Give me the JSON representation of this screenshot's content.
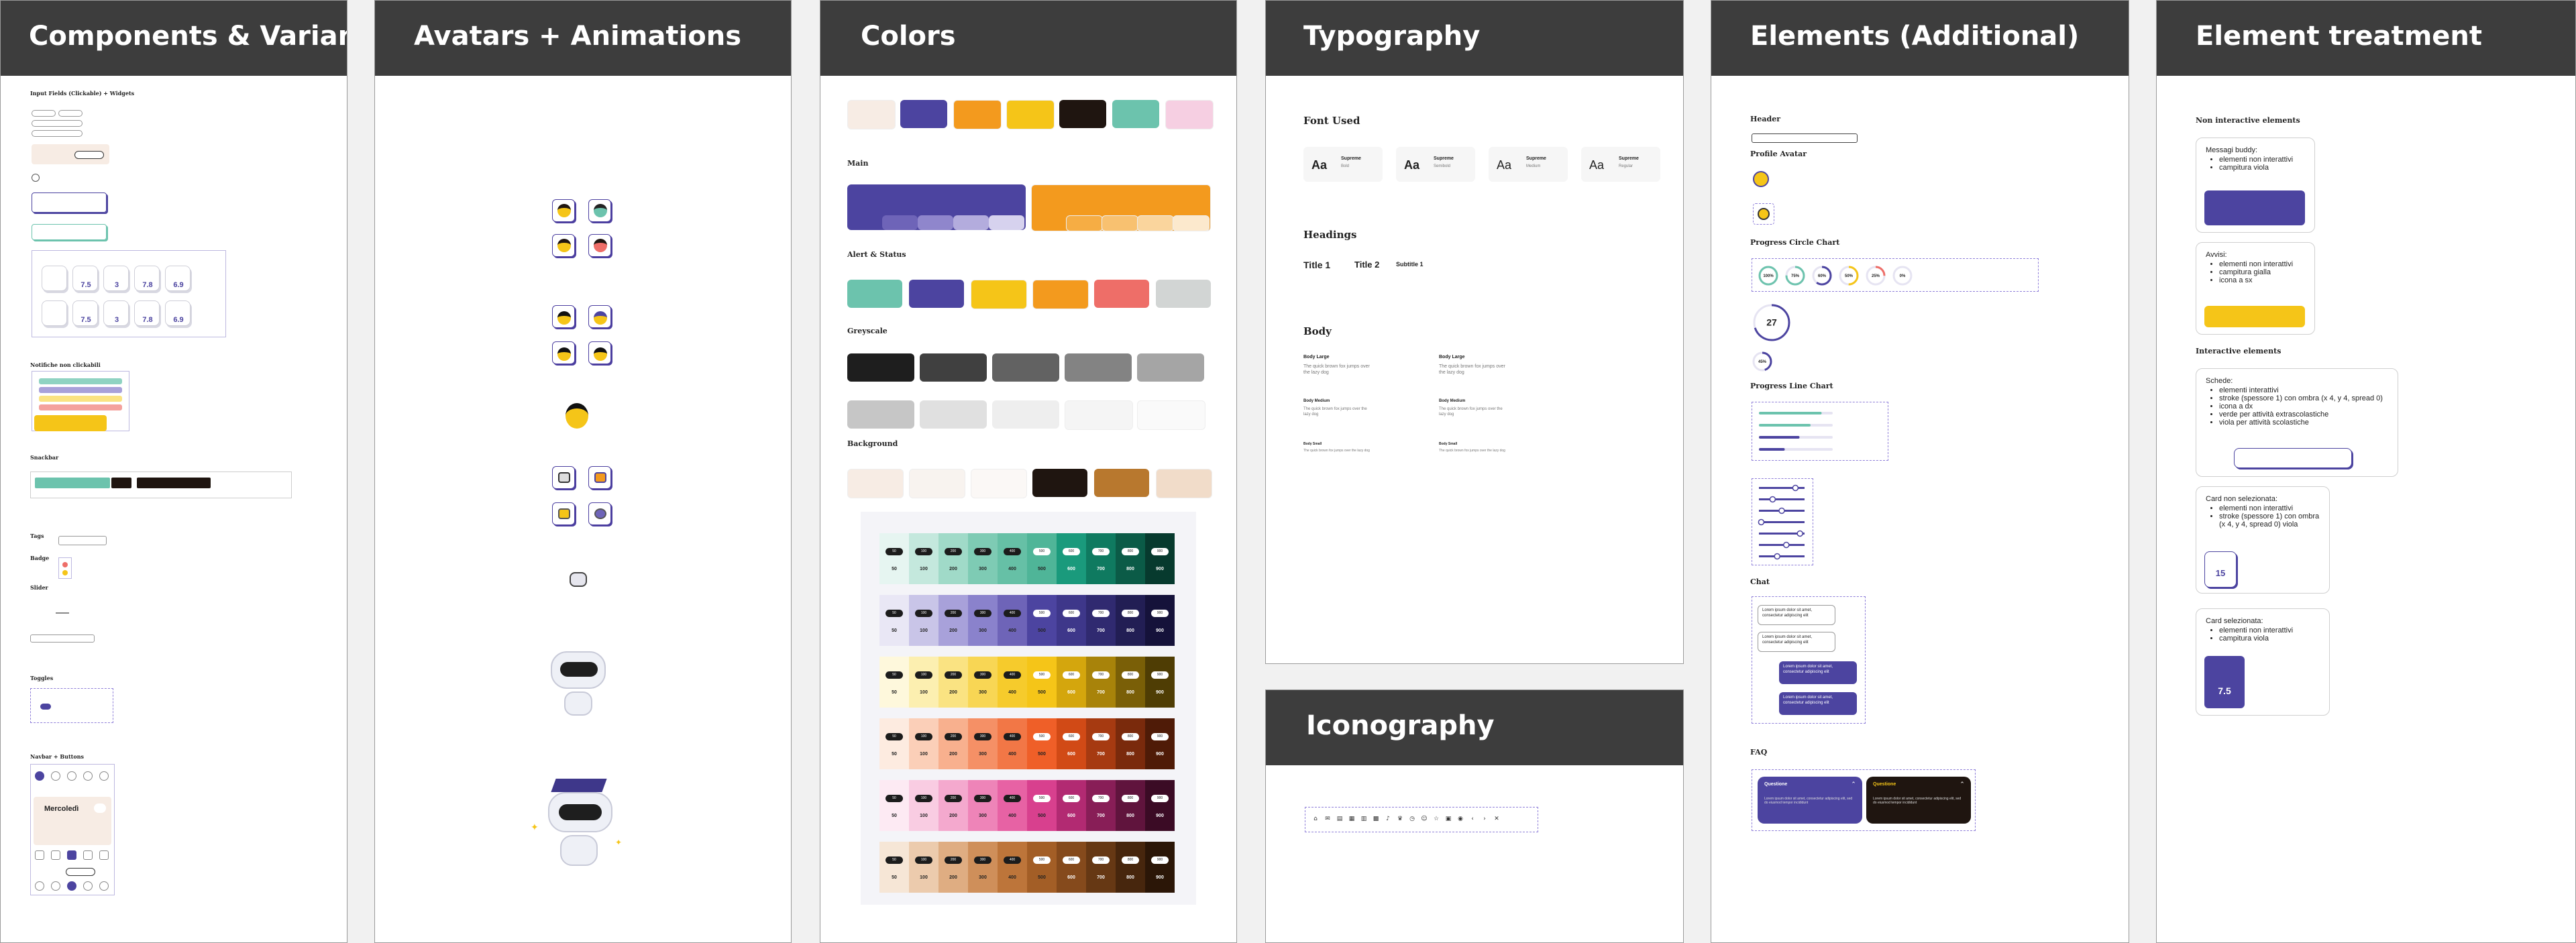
{
  "boards": {
    "components": "Components & Variants",
    "avatars": "Avatars + Animations",
    "colors": "Colors",
    "typography": "Typography",
    "elements": "Elements (Additional)",
    "treatment": "Element treatment",
    "iconography": "Iconography"
  },
  "components": {
    "input_fields": "Input Fields (Clickable) + Widgets",
    "notifiche": "Notifiche non clickabili",
    "snackbar": "Snackbar",
    "tags": "Tags",
    "badge": "Badge",
    "slider": "Slider",
    "toggles": "Toggles",
    "navbar": "Navbar + Buttons",
    "navbar_day": "Mercoledì",
    "grade_values": [
      "7.5",
      "3",
      "7.8",
      "6.9",
      "7.5",
      "3",
      "7.8",
      "6.9"
    ]
  },
  "avatars": {
    "avatar_count": 10
  },
  "colors": {
    "main": "Main",
    "alert": "Alert & Status",
    "greyscale": "Greyscale",
    "background": "Background",
    "top_swatches": [
      "#f7ece4",
      "#4c44a0",
      "#f39a1e",
      "#f5c518",
      "#1f1510",
      "#6cc3ad",
      "#f6cfe2"
    ],
    "main_swatches": [
      "#4c44a0",
      "#f39a1e"
    ],
    "main_tints": [
      "#6e64b8",
      "#8f86cc",
      "#b3acdd",
      "#d6d2ee",
      "#f6ad44",
      "#f8c170",
      "#fad59d",
      "#fce9cd"
    ],
    "alert_swatches": [
      "#6cc3ad",
      "#4c44a0",
      "#f5c518",
      "#f39a1e",
      "#ee6e68",
      "#d2d5d4"
    ],
    "greyscale_swatches": [
      "#1e1e1e",
      "#404040",
      "#626262",
      "#838383",
      "#a5a5a5",
      "#c6c6c6",
      "#e0e0e0",
      "#eeeeee",
      "#f5f5f5",
      "#fafafa"
    ],
    "background_swatches": [
      "#f7ece4",
      "#f8f3ef",
      "#fbf8f6",
      "#1f1510",
      "#b8782e",
      "#f1dcc9"
    ],
    "shade_steps": [
      "50",
      "100",
      "200",
      "300",
      "400",
      "500",
      "600",
      "700",
      "800",
      "900"
    ],
    "palettes": [
      [
        "#e6f5f1",
        "#c4e8dd",
        "#a0dac8",
        "#7ecbb4",
        "#66c0a6",
        "#4fb598",
        "#1a9a7c",
        "#0f7a60",
        "#0b5b47",
        "#073a2e"
      ],
      [
        "#e9e7f5",
        "#c9c5e8",
        "#a8a1da",
        "#8a82cc",
        "#6e64b8",
        "#4c44a0",
        "#3e378a",
        "#302a70",
        "#221e54",
        "#15123a"
      ],
      [
        "#fef8dc",
        "#fcefb0",
        "#fae382",
        "#f8d654",
        "#f6cb2c",
        "#f5c518",
        "#d4a60d",
        "#a8830a",
        "#7a5f07",
        "#4f3d04"
      ],
      [
        "#fdebe0",
        "#fbcfb8",
        "#f8b08e",
        "#f59066",
        "#f27746",
        "#ef5f28",
        "#d14a16",
        "#a63a11",
        "#7a2a0c",
        "#4f1b07"
      ],
      [
        "#fdeaf3",
        "#f9cce2",
        "#f4a9ce",
        "#ee84b8",
        "#e762a4",
        "#d8408e",
        "#b22a72",
        "#881e57",
        "#60143d",
        "#3b0b25"
      ],
      [
        "#f6e6d6",
        "#eccbad",
        "#dfad82",
        "#cf8f5a",
        "#bd753a",
        "#a35e26",
        "#854a1c",
        "#663814",
        "#47260d",
        "#2b1607"
      ]
    ]
  },
  "typography": {
    "font_used": "Font Used",
    "aa": "Aa",
    "font_name": "Supreme",
    "font_weights": [
      "Bold",
      "Semibold",
      "Medium",
      "Regular"
    ],
    "headings": "Headings",
    "title1": "Title 1",
    "title2": "Title 2",
    "subtitle1": "Subtitle 1",
    "body": "Body",
    "body_large": "Body Large",
    "body_medium": "Body Medium",
    "body_small": "Body Small",
    "sample": "The quick brown fox jumps over the lazy dog"
  },
  "elements": {
    "header": "Header",
    "profile_avatar": "Profile Avatar",
    "progress_circle": "Progress Circle Chart",
    "circle_values": [
      "100%",
      "75%",
      "60%",
      "50%",
      "25%",
      "0%"
    ],
    "big_circle": "27",
    "small_circle": "45%",
    "progress_line": "Progress Line Chart",
    "line_values": [
      0.85,
      0.7,
      0.55,
      0.35
    ],
    "chat": "Chat",
    "chat_text": "Lorem ipsum dolor sit amet, consectetur adipiscing elit",
    "faq": "FAQ",
    "faq_title": "Questione",
    "faq_body": "Lorem ipsum dolor sit amet, consectetur adipiscing elit, sed do eiusmod tempor incididunt"
  },
  "treatment": {
    "non_interactive": "Non interactive elements",
    "interactive": "Interactive elements",
    "note1_title": "Messagi buddy:",
    "note1_items": [
      "elementi non interattivi",
      "campitura viola"
    ],
    "note2_title": "Avvisi:",
    "note2_items": [
      "elementi non interattivi",
      "campitura gialla",
      "icona a sx"
    ],
    "note3_title": "Schede:",
    "note3_items": [
      "elementi interattivi",
      "stroke (spessore 1) con ombra (x 4, y 4, spread 0)",
      "icona a dx",
      "verde per attività extrascolastiche",
      "viola per attività scolastiche"
    ],
    "note4_title": "Card non selezionata:",
    "note4_items": [
      "elementi non interattivi",
      "stroke (spessore 1) con ombra (x 4, y 4, spread 0) viola"
    ],
    "note5_title": "Card selezionata:",
    "note5_items": [
      "elementi non interattivi",
      "campitura viola"
    ],
    "card_value_a": "15",
    "card_value_b": "7.5"
  }
}
